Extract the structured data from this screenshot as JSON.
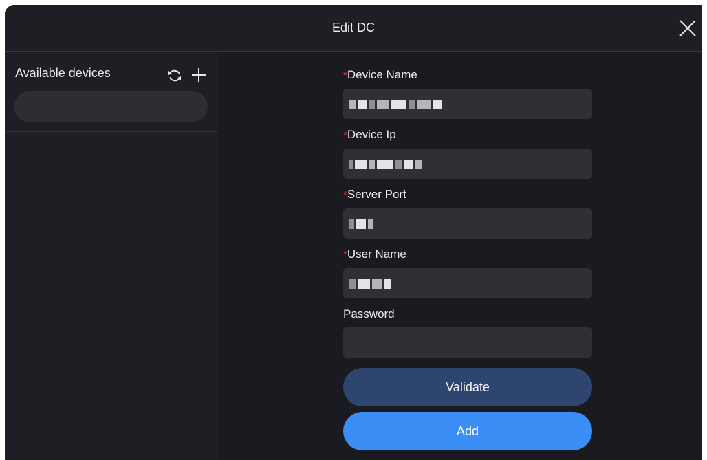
{
  "dialog": {
    "title": "Edit DC",
    "close_icon": "close-icon"
  },
  "sidebar": {
    "title": "Available devices",
    "refresh_icon": "refresh-icon",
    "add_icon": "plus-icon",
    "search_value": ""
  },
  "form": {
    "required_marker": "*",
    "fields": [
      {
        "label": "Device Name",
        "required": true,
        "value": "(redacted)"
      },
      {
        "label": "Device Ip",
        "required": true,
        "value": "(redacted)"
      },
      {
        "label": "Server Port",
        "required": true,
        "value": "(redacted)"
      },
      {
        "label": "User Name",
        "required": true,
        "value": "(redacted)"
      },
      {
        "label": "Password",
        "required": false,
        "value": ""
      }
    ],
    "validate_label": "Validate",
    "add_label": "Add"
  },
  "colors": {
    "background": "#1a1b20",
    "panel": "#1e1f25",
    "input": "#2f3035",
    "required": "#e0383e",
    "validate_button": "#2e4570",
    "add_button": "#3b8ef5"
  }
}
